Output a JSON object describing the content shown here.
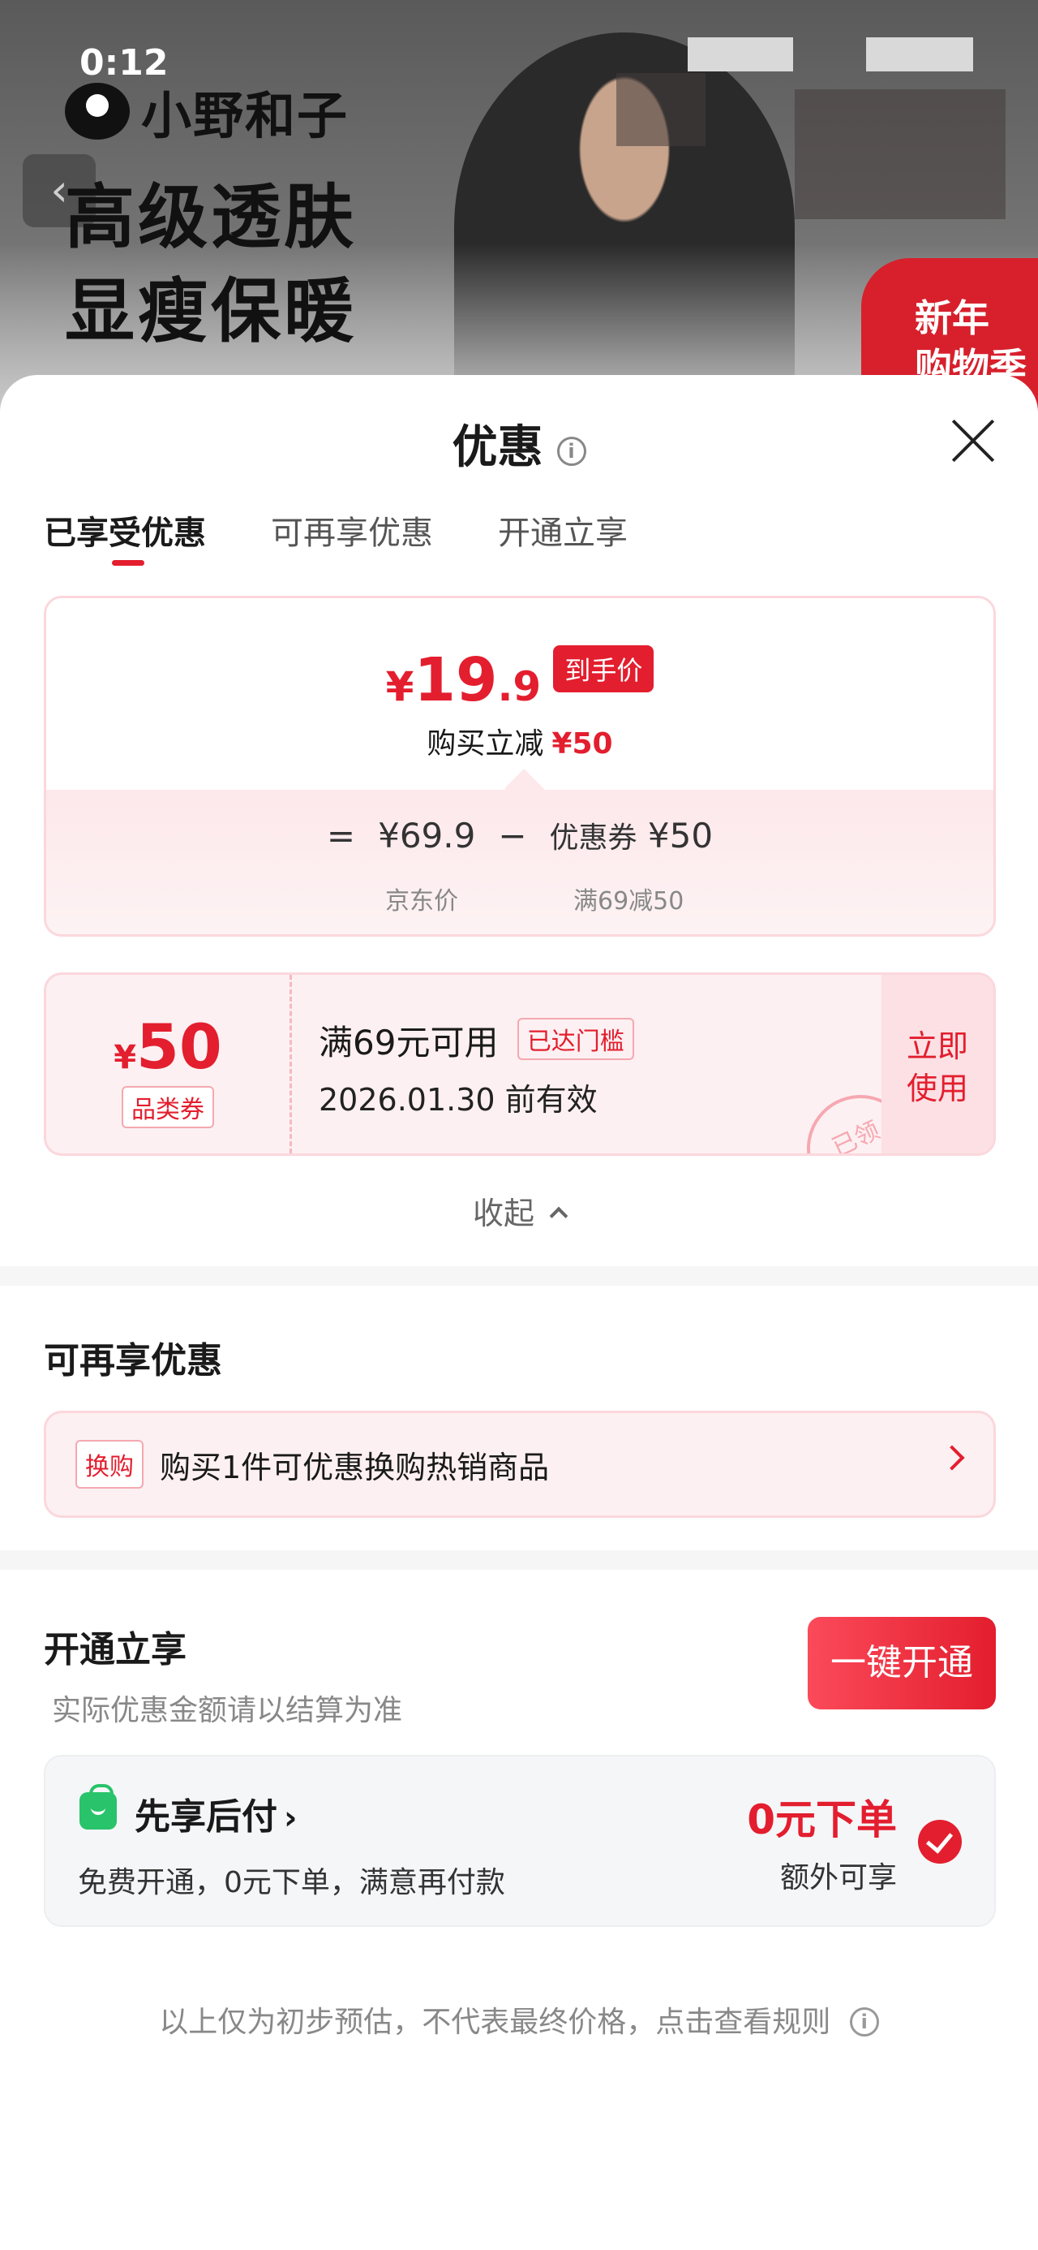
{
  "status": {
    "time": "0:12"
  },
  "banner": {
    "brand": "小野和子",
    "slogan_line1": "高级透肤",
    "slogan_line2": "显瘦保暖",
    "badge_line1": "新年",
    "badge_line2": "购物季"
  },
  "sheet": {
    "title": "优惠",
    "tabs": [
      "已享受优惠",
      "可再享优惠",
      "开通立享"
    ]
  },
  "price": {
    "currency": "¥",
    "final_int": "19",
    "final_dec": ".9",
    "final_tag": "到手价",
    "discount_label": "购买立减",
    "discount_value": "¥50",
    "eq": "=",
    "jd_price": "¥69.9",
    "minus": "−",
    "coupon_label": "优惠券",
    "coupon_value": "¥50",
    "jd_price_label": "京东价",
    "coupon_rule": "满69减50"
  },
  "coupon": {
    "currency": "¥",
    "amount": "50",
    "type": "品类券",
    "condition": "满69元可用",
    "threshold_tag": "已达门槛",
    "valid": "2026.01.30 前有效",
    "action_line1": "立即",
    "action_line2": "使用",
    "stamp": "已领"
  },
  "collapse_label": "收起",
  "more": {
    "title": "可再享优惠",
    "swap_tag": "换购",
    "swap_text": "购买1件可优惠换购热销商品"
  },
  "open": {
    "title": "开通立享",
    "subtitle": "实际优惠金额请以结算为准",
    "button": "一键开通",
    "pay_title": "先享后付",
    "pay_desc": "免费开通，0元下单，满意再付款",
    "pay_highlight": "0元下单",
    "pay_extra": "额外可享"
  },
  "footer": "以上仅为初步预估，不代表最终价格，点击查看规则",
  "colors": {
    "accent": "#e31e2e",
    "success": "#28c36a"
  }
}
